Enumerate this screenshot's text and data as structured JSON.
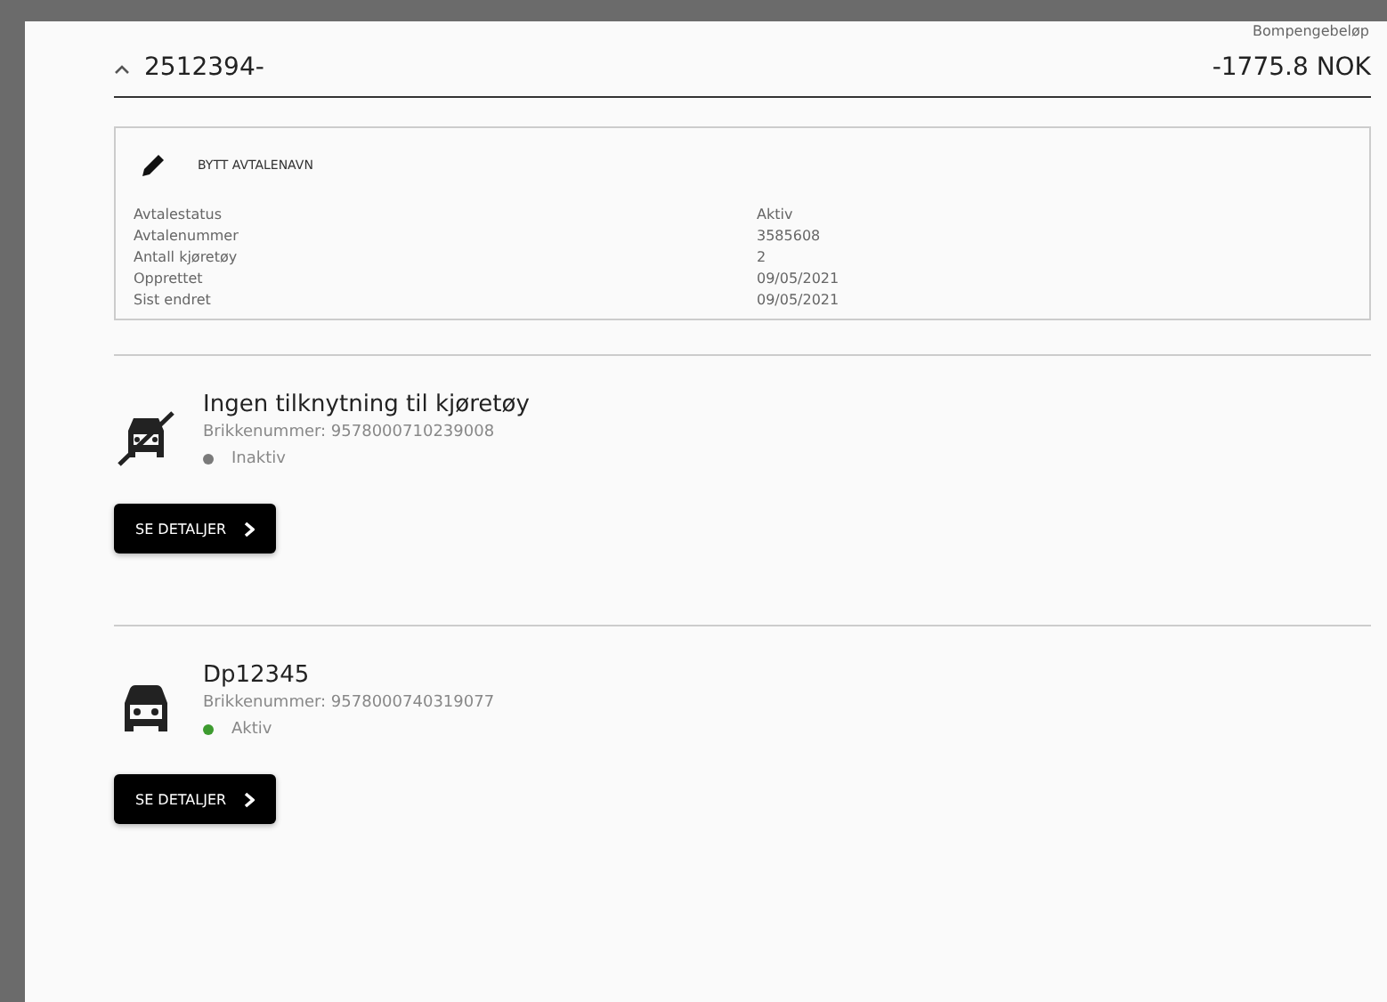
{
  "amount_label": "Bompengebeløp",
  "agreement": {
    "name": "2512394-",
    "expanded": true,
    "amount": "-1775.8 NOK"
  },
  "details": {
    "rename_label": "BYTT AVTALENAVN",
    "rows": [
      {
        "label": "Avtalestatus",
        "value": "Aktiv"
      },
      {
        "label": "Avtalenummer",
        "value": "3585608"
      },
      {
        "label": "Antall kjøretøy",
        "value": "2"
      },
      {
        "label": "Opprettet",
        "value": "09/05/2021"
      },
      {
        "label": "Sist endret",
        "value": "09/05/2021"
      }
    ]
  },
  "vehicles": [
    {
      "kind": "unlinked",
      "title": "Ingen tilknytning til kjøretøy",
      "tag": "Brikkenummer: 9578000710239008",
      "status": "Inaktiv",
      "color": "#7a7a7a",
      "button": "SE DETALJER"
    },
    {
      "kind": "car",
      "title": "Dp12345",
      "tag": "Brikkenummer: 9578000740319077",
      "status": "Aktiv",
      "color": "#3d9b2f",
      "button": "SE DETALJER"
    }
  ]
}
